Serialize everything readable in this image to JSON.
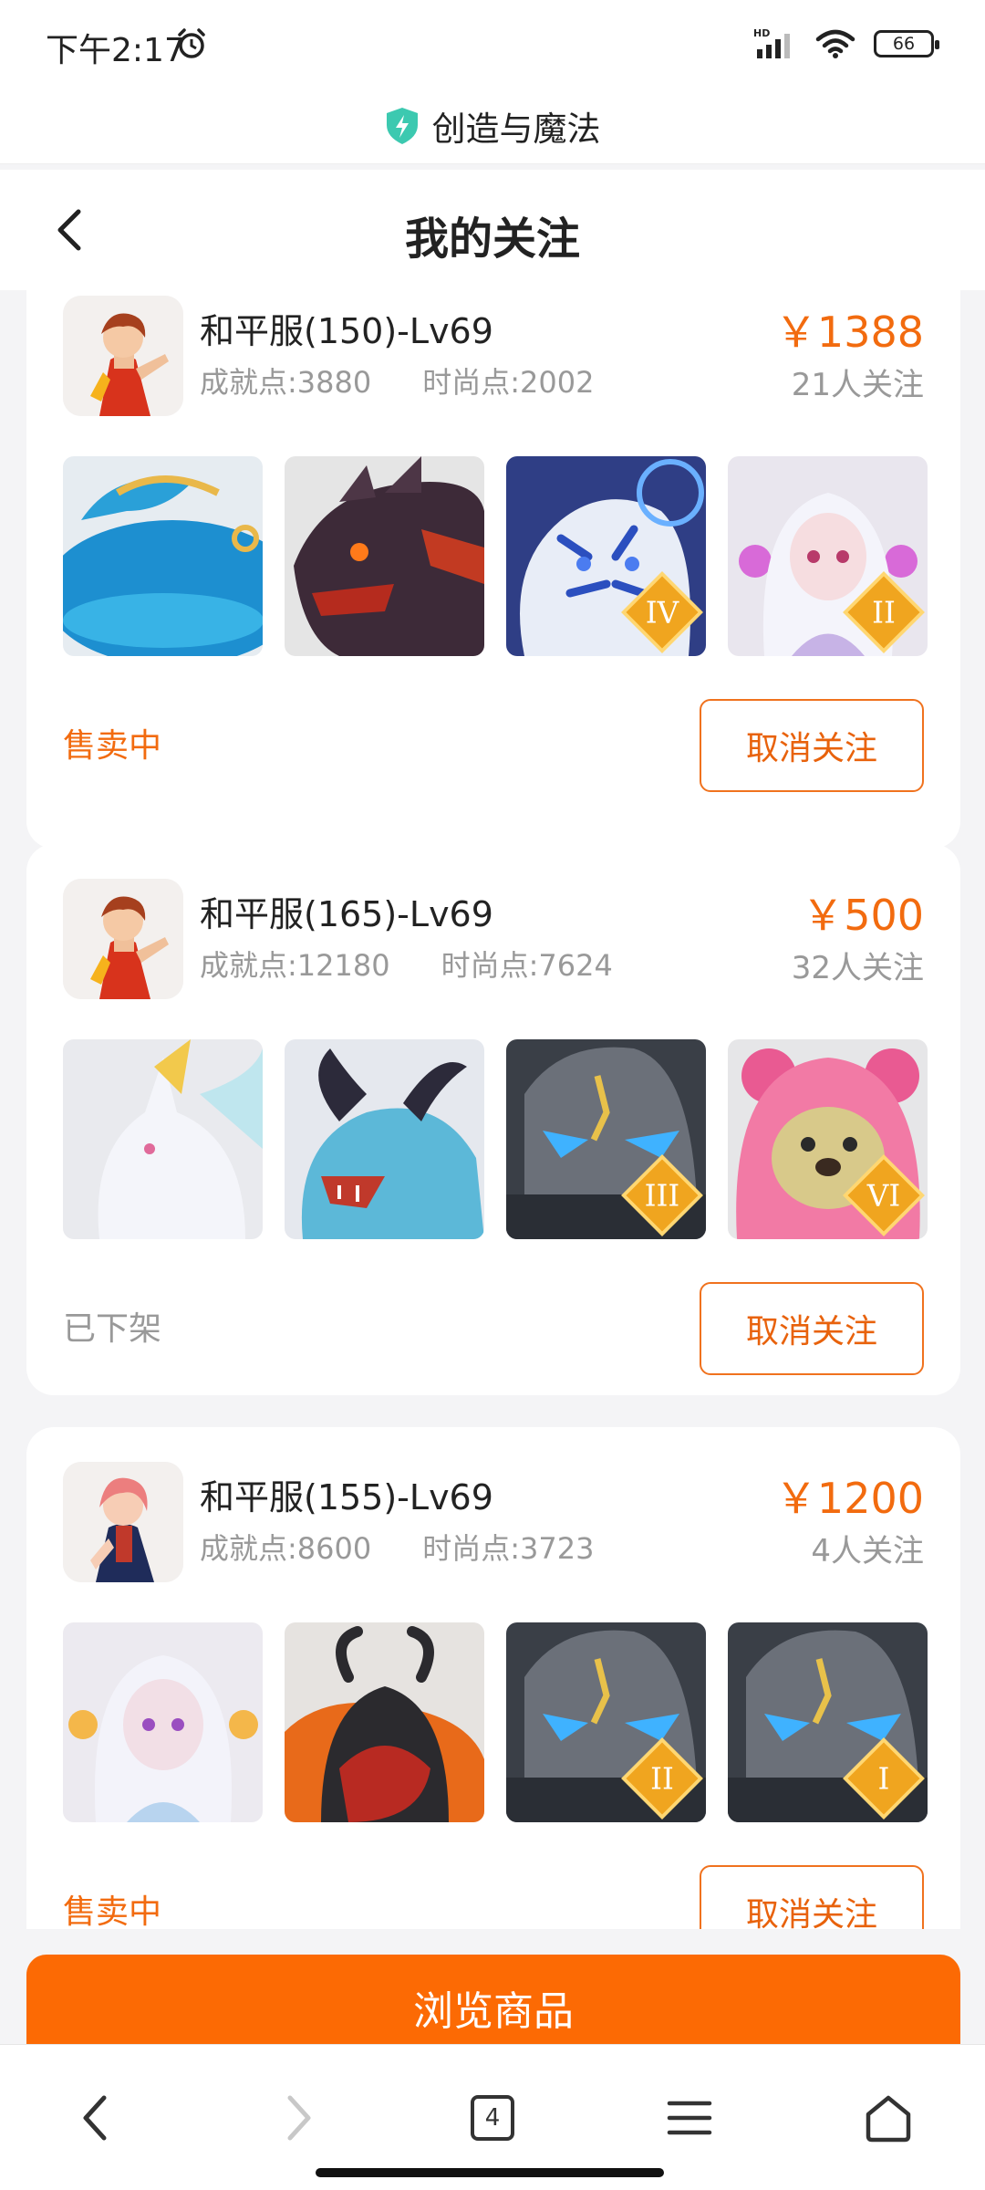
{
  "status_bar": {
    "time": "下午2:17",
    "network": "HD",
    "battery": "66"
  },
  "site": {
    "name": "创造与魔法"
  },
  "page": {
    "title": "我的关注"
  },
  "items": [
    {
      "title": "和平服(150)-Lv69",
      "achievement": "成就点:3880",
      "fashion": "时尚点:2002",
      "price": "￥1388",
      "followers": "21人关注",
      "status": "售卖中",
      "unfollow_label": "取消关注",
      "thumbs": [
        {
          "name": "whale",
          "badge": ""
        },
        {
          "name": "dark-dragon",
          "badge": ""
        },
        {
          "name": "white-tiger",
          "badge": "IV"
        },
        {
          "name": "white-hair-girl",
          "badge": "II"
        }
      ]
    },
    {
      "title": "和平服(165)-Lv69",
      "achievement": "成就点:12180",
      "fashion": "时尚点:7624",
      "price": "￥500",
      "followers": "32人关注",
      "status": "已下架",
      "unfollow_label": "取消关注",
      "thumbs": [
        {
          "name": "white-fox",
          "badge": ""
        },
        {
          "name": "blue-dragon",
          "badge": ""
        },
        {
          "name": "stone-golem",
          "badge": "III"
        },
        {
          "name": "pink-bear",
          "badge": "VI"
        }
      ]
    },
    {
      "title": "和平服(155)-Lv69",
      "achievement": "成就点:8600",
      "fashion": "时尚点:3723",
      "price": "￥1200",
      "followers": "4人关注",
      "status": "售卖中",
      "unfollow_label": "取消关注",
      "thumbs": [
        {
          "name": "white-hair-girl",
          "badge": ""
        },
        {
          "name": "black-goat-beast",
          "badge": ""
        },
        {
          "name": "stone-golem",
          "badge": "II"
        },
        {
          "name": "stone-golem",
          "badge": "I"
        }
      ]
    }
  ],
  "browse_button": {
    "label": "浏览商品"
  },
  "browser": {
    "tab_count": "4"
  },
  "colors": {
    "accent": "#fc6a04",
    "price": "#f26b0f"
  }
}
